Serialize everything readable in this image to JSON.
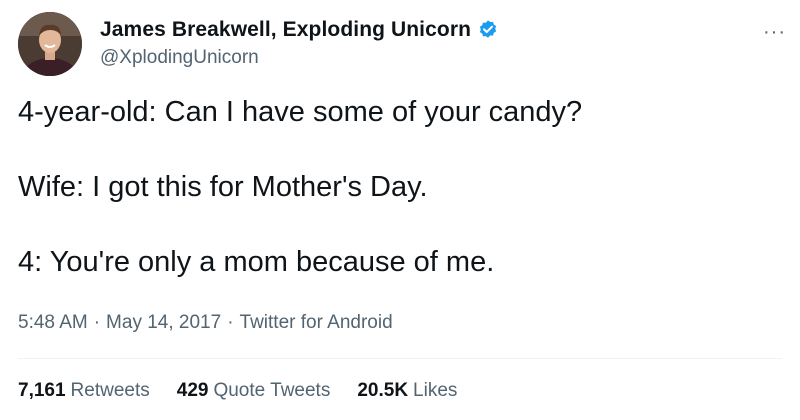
{
  "author": {
    "display_name": "James Breakwell, Exploding Unicorn",
    "handle": "@XplodingUnicorn",
    "verified_icon": "verified-badge-icon",
    "avatar_icon": "avatar"
  },
  "more_icon": "···",
  "tweet": {
    "lines": [
      "4-year-old: Can I have some of your candy?",
      "Wife: I got this for Mother's Day.",
      "4: You're only a mom because of me."
    ]
  },
  "meta": {
    "time": "5:48 AM",
    "date": "May 14, 2017",
    "source": "Twitter for Android",
    "separator": "·"
  },
  "stats": {
    "retweets_count": "7,161",
    "retweets_label": "Retweets",
    "quotes_count": "429",
    "quotes_label": "Quote Tweets",
    "likes_count": "20.5K",
    "likes_label": "Likes"
  },
  "colors": {
    "text": "#0f1419",
    "secondary": "#536471",
    "verified": "#1d9bf0",
    "divider": "#eff3f4"
  }
}
